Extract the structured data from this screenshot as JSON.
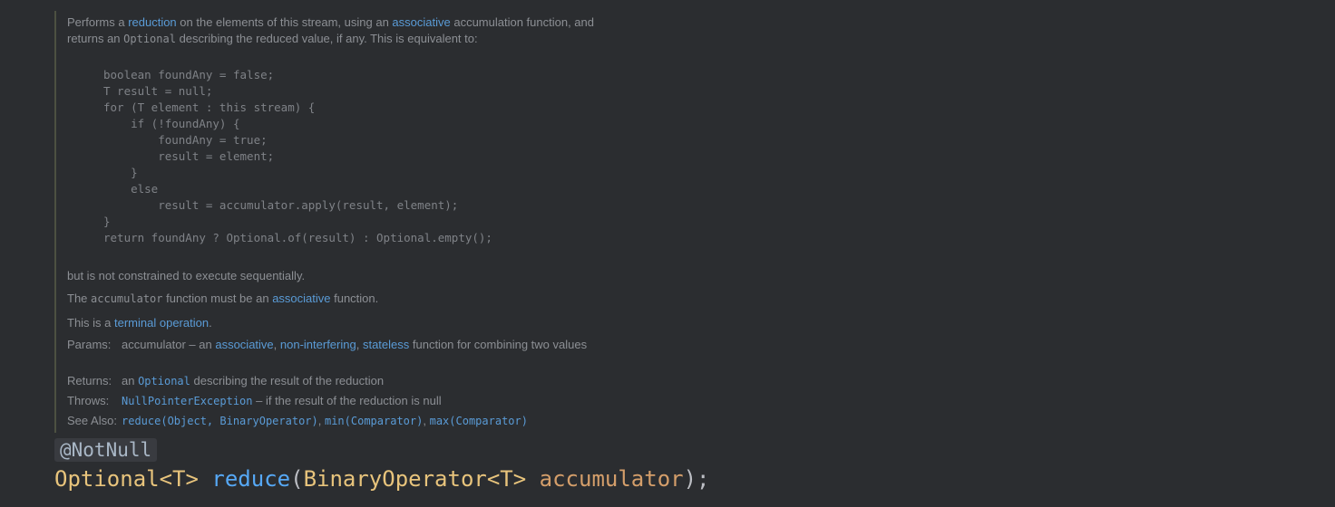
{
  "intro": {
    "t1": "Performs a ",
    "l1": "reduction",
    "t2": " on the elements of this stream, using an ",
    "l2": "associative",
    "t3": " accumulation function, and returns an ",
    "c1": "Optional",
    "t4": " describing the reduced value, if any. This is equivalent to:"
  },
  "code": {
    "lines": [
      "boolean foundAny = false;",
      "T result = null;",
      "for (T element : this stream) {",
      "    if (!foundAny) {",
      "        foundAny = true;",
      "        result = element;",
      "    }",
      "    else",
      "        result = accumulator.apply(result, element);",
      "}",
      "return foundAny ? Optional.of(result) : Optional.empty();"
    ]
  },
  "sequential": "but is not constrained to execute sequentially.",
  "accum": {
    "t1": "The ",
    "c1": "accumulator",
    "t2": " function must be an ",
    "l1": "associative",
    "t3": " function."
  },
  "terminal": {
    "t1": "This is a ",
    "l1": "terminal operation",
    "t2": "."
  },
  "params": {
    "label": "Params:",
    "t1": "accumulator – an ",
    "l1": "associative",
    "s1": ", ",
    "l2": "non-interfering",
    "s2": ", ",
    "l3": "stateless",
    "t2": " function for combining two values"
  },
  "returns": {
    "label": "Returns:",
    "t1": "an ",
    "l1": "Optional",
    "t2": " describing the result of the reduction"
  },
  "throws": {
    "label": "Throws:",
    "l1": "NullPointerException",
    "t1": " – if the result of the reduction is null"
  },
  "see_also": {
    "label": "See Also:",
    "l1": "reduce(Object, BinaryOperator)",
    "s1": ", ",
    "l2": "min(Comparator)",
    "s2": ", ",
    "l3": "max(Comparator)"
  },
  "annotation": "@NotNull",
  "signature": {
    "ret_type": "Optional<T>",
    "name": "reduce",
    "open": "(",
    "param_type": "BinaryOperator<T>",
    "param_name": "accumulator",
    "close": ");"
  },
  "colors": {
    "background": "#2b2d30",
    "doc_text": "#8c8f94",
    "link": "#5a9bd6",
    "type": "#e8c47c",
    "method": "#56a8f5",
    "param": "#d49e6a"
  }
}
